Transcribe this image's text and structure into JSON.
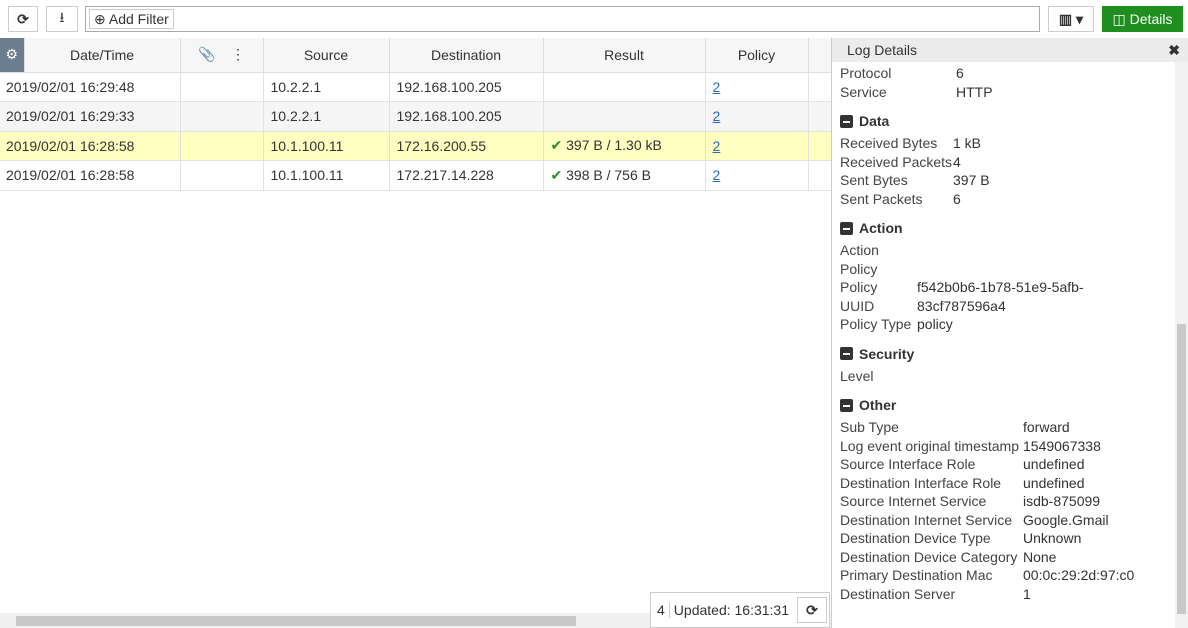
{
  "toolbar": {
    "add_filter": "Add Filter",
    "details": "Details"
  },
  "table": {
    "headers": [
      "Date/Time",
      "Source",
      "Destination",
      "Result",
      "Policy"
    ],
    "rows": [
      {
        "time": "2019/02/01 16:29:48",
        "source": "10.2.2.1",
        "destination": "192.168.100.205",
        "result": "",
        "policy": "2"
      },
      {
        "time": "2019/02/01 16:29:33",
        "source": "10.2.2.1",
        "destination": "192.168.100.205",
        "result": "",
        "policy": "2"
      },
      {
        "time": "2019/02/01 16:28:58",
        "source": "10.1.100.11",
        "destination": "172.16.200.55",
        "result": "397 B / 1.30 kB",
        "policy": "2"
      },
      {
        "time": "2019/02/01 16:28:58",
        "source": "10.1.100.11",
        "destination": "172.217.14.228",
        "result": "398 B / 756 B",
        "policy": "2"
      }
    ]
  },
  "status": {
    "count": "4",
    "updated": "Updated: 16:31:31"
  },
  "panel": {
    "title": "Log Details",
    "top": [
      [
        "Protocol",
        "6"
      ],
      [
        "Service",
        "HTTP"
      ]
    ],
    "data_title": "Data",
    "data": [
      [
        "Received Bytes",
        "1 kB"
      ],
      [
        "Received Packets",
        "4"
      ],
      [
        "Sent Bytes",
        "397 B"
      ],
      [
        "Sent Packets",
        "6"
      ]
    ],
    "action_title": "Action",
    "action": [
      [
        "Action",
        ""
      ],
      [
        "Policy",
        ""
      ],
      [
        "Policy UUID",
        "f542b0b6-1b78-51e9-5afb-83cf787596a4"
      ],
      [
        "Policy Type",
        "policy"
      ]
    ],
    "security_title": "Security",
    "security": [
      [
        "Level",
        ""
      ]
    ],
    "other_title": "Other",
    "other": [
      [
        "Sub Type",
        "forward"
      ],
      [
        "Log event original timestamp",
        "1549067338"
      ],
      [
        "Source Interface Role",
        "undefined"
      ],
      [
        "Destination Interface Role",
        "undefined"
      ],
      [
        "Source Internet Service",
        "isdb-875099"
      ],
      [
        "Destination Internet Service",
        "Google.Gmail"
      ],
      [
        "Destination Device Type",
        "Unknown"
      ],
      [
        "Destination Device Category",
        "None"
      ],
      [
        "Primary Destination Mac",
        "00:0c:29:2d:97:c0"
      ],
      [
        "Destination Server",
        "1"
      ]
    ]
  }
}
